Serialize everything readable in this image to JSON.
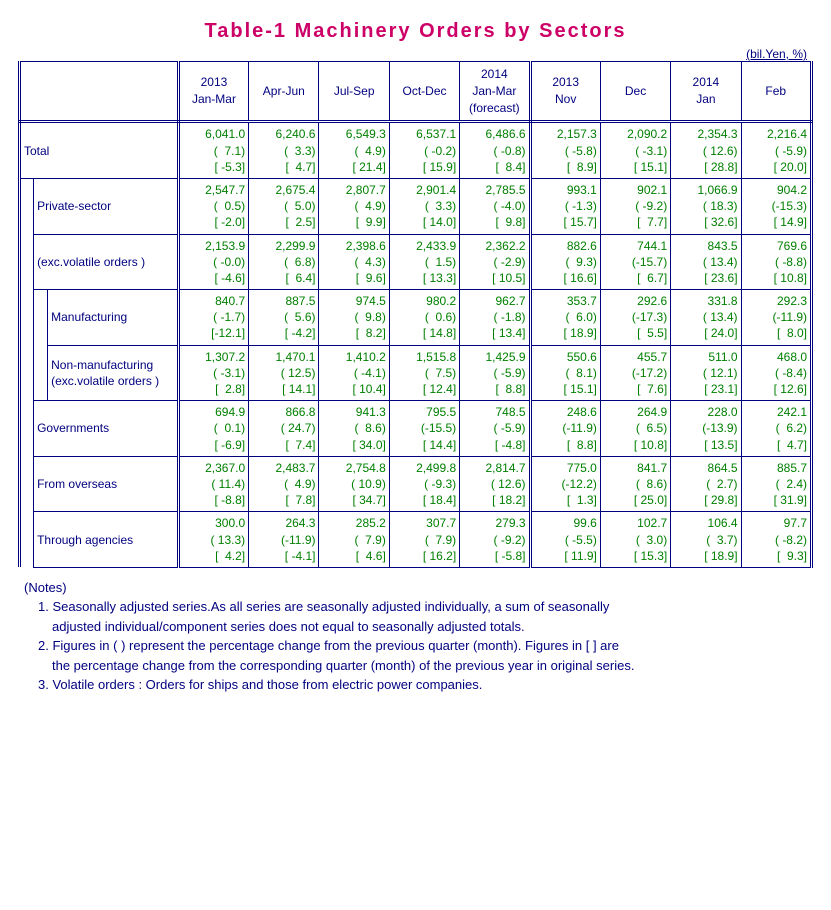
{
  "title": "Table-1   Machinery   Orders   by   Sectors",
  "unit": "(bil.Yen, %)",
  "columns": [
    {
      "l1": "2013",
      "l2": "Jan-Mar",
      "l3": ""
    },
    {
      "l1": "",
      "l2": "Apr-Jun",
      "l3": ""
    },
    {
      "l1": "",
      "l2": "Jul-Sep",
      "l3": ""
    },
    {
      "l1": "",
      "l2": "Oct-Dec",
      "l3": ""
    },
    {
      "l1": "2014",
      "l2": "Jan-Mar",
      "l3": "(forecast)"
    },
    {
      "l1": "2013",
      "l2": "Nov",
      "l3": ""
    },
    {
      "l1": "",
      "l2": "Dec",
      "l3": ""
    },
    {
      "l1": "2014",
      "l2": "Jan",
      "l3": ""
    },
    {
      "l1": "",
      "l2": "Feb",
      "l3": ""
    }
  ],
  "rows": [
    {
      "indent": 0,
      "label": "Total",
      "cells": [
        {
          "v": "6,041.0",
          "p": "(  7.1)",
          "b": "[ -5.3]"
        },
        {
          "v": "6,240.6",
          "p": "(  3.3)",
          "b": "[  4.7]"
        },
        {
          "v": "6,549.3",
          "p": "(  4.9)",
          "b": "[ 21.4]"
        },
        {
          "v": "6,537.1",
          "p": "( -0.2)",
          "b": "[ 15.9]"
        },
        {
          "v": "6,486.6",
          "p": "( -0.8)",
          "b": "[  8.4]"
        },
        {
          "v": "2,157.3",
          "p": "( -5.8)",
          "b": "[  8.9]"
        },
        {
          "v": "2,090.2",
          "p": "( -3.1)",
          "b": "[ 15.1]"
        },
        {
          "v": "2,354.3",
          "p": "( 12.6)",
          "b": "[ 28.8]"
        },
        {
          "v": "2,216.4",
          "p": "( -5.9)",
          "b": "[ 20.0]"
        }
      ]
    },
    {
      "indent": 1,
      "label": "Private-sector",
      "cells": [
        {
          "v": "2,547.7",
          "p": "(  0.5)",
          "b": "[ -2.0]"
        },
        {
          "v": "2,675.4",
          "p": "(  5.0)",
          "b": "[  2.5]"
        },
        {
          "v": "2,807.7",
          "p": "(  4.9)",
          "b": "[  9.9]"
        },
        {
          "v": "2,901.4",
          "p": "(  3.3)",
          "b": "[ 14.0]"
        },
        {
          "v": "2,785.5",
          "p": "( -4.0)",
          "b": "[  9.8]"
        },
        {
          "v": "993.1",
          "p": "( -1.3)",
          "b": "[ 15.7]"
        },
        {
          "v": "902.1",
          "p": "( -9.2)",
          "b": "[  7.7]"
        },
        {
          "v": "1,066.9",
          "p": "( 18.3)",
          "b": "[ 32.6]"
        },
        {
          "v": "904.2",
          "p": "(-15.3)",
          "b": "[ 14.9]"
        }
      ]
    },
    {
      "indent": 1,
      "label": "(exc.volatile orders )",
      "cells": [
        {
          "v": "2,153.9",
          "p": "( -0.0)",
          "b": "[ -4.6]"
        },
        {
          "v": "2,299.9",
          "p": "(  6.8)",
          "b": "[  6.4]"
        },
        {
          "v": "2,398.6",
          "p": "(  4.3)",
          "b": "[  9.6]"
        },
        {
          "v": "2,433.9",
          "p": "(  1.5)",
          "b": "[ 13.3]"
        },
        {
          "v": "2,362.2",
          "p": "( -2.9)",
          "b": "[ 10.5]"
        },
        {
          "v": "882.6",
          "p": "(  9.3)",
          "b": "[ 16.6]"
        },
        {
          "v": "744.1",
          "p": "(-15.7)",
          "b": "[  6.7]"
        },
        {
          "v": "843.5",
          "p": "( 13.4)",
          "b": "[ 23.6]"
        },
        {
          "v": "769.6",
          "p": "( -8.8)",
          "b": "[ 10.8]"
        }
      ]
    },
    {
      "indent": 2,
      "label": "Manufacturing",
      "cells": [
        {
          "v": "840.7",
          "p": "( -1.7)",
          "b": "[-12.1]"
        },
        {
          "v": "887.5",
          "p": "(  5.6)",
          "b": "[ -4.2]"
        },
        {
          "v": "974.5",
          "p": "(  9.8)",
          "b": "[  8.2]"
        },
        {
          "v": "980.2",
          "p": "(  0.6)",
          "b": "[ 14.8]"
        },
        {
          "v": "962.7",
          "p": "( -1.8)",
          "b": "[ 13.4]"
        },
        {
          "v": "353.7",
          "p": "(  6.0)",
          "b": "[ 18.9]"
        },
        {
          "v": "292.6",
          "p": "(-17.3)",
          "b": "[  5.5]"
        },
        {
          "v": "331.8",
          "p": "( 13.4)",
          "b": "[ 24.0]"
        },
        {
          "v": "292.3",
          "p": "(-11.9)",
          "b": "[  8.0]"
        }
      ]
    },
    {
      "indent": 2,
      "label": "Non-manufacturing (exc.volatile orders )",
      "cells": [
        {
          "v": "1,307.2",
          "p": "( -3.1)",
          "b": "[  2.8]"
        },
        {
          "v": "1,470.1",
          "p": "( 12.5)",
          "b": "[ 14.1]"
        },
        {
          "v": "1,410.2",
          "p": "( -4.1)",
          "b": "[ 10.4]"
        },
        {
          "v": "1,515.8",
          "p": "(  7.5)",
          "b": "[ 12.4]"
        },
        {
          "v": "1,425.9",
          "p": "( -5.9)",
          "b": "[  8.8]"
        },
        {
          "v": "550.6",
          "p": "(  8.1)",
          "b": "[ 15.1]"
        },
        {
          "v": "455.7",
          "p": "(-17.2)",
          "b": "[  7.6]"
        },
        {
          "v": "511.0",
          "p": "( 12.1)",
          "b": "[ 23.1]"
        },
        {
          "v": "468.0",
          "p": "( -8.4)",
          "b": "[ 12.6]"
        }
      ]
    },
    {
      "indent": 1,
      "label": "Governments",
      "cells": [
        {
          "v": "694.9",
          "p": "(  0.1)",
          "b": "[ -6.9]"
        },
        {
          "v": "866.8",
          "p": "( 24.7)",
          "b": "[  7.4]"
        },
        {
          "v": "941.3",
          "p": "(  8.6)",
          "b": "[ 34.0]"
        },
        {
          "v": "795.5",
          "p": "(-15.5)",
          "b": "[ 14.4]"
        },
        {
          "v": "748.5",
          "p": "( -5.9)",
          "b": "[ -4.8]"
        },
        {
          "v": "248.6",
          "p": "(-11.9)",
          "b": "[  8.8]"
        },
        {
          "v": "264.9",
          "p": "(  6.5)",
          "b": "[ 10.8]"
        },
        {
          "v": "228.0",
          "p": "(-13.9)",
          "b": "[ 13.5]"
        },
        {
          "v": "242.1",
          "p": "(  6.2)",
          "b": "[  4.7]"
        }
      ]
    },
    {
      "indent": 1,
      "label": "From overseas",
      "cells": [
        {
          "v": "2,367.0",
          "p": "( 11.4)",
          "b": "[ -8.8]"
        },
        {
          "v": "2,483.7",
          "p": "(  4.9)",
          "b": "[  7.8]"
        },
        {
          "v": "2,754.8",
          "p": "( 10.9)",
          "b": "[ 34.7]"
        },
        {
          "v": "2,499.8",
          "p": "( -9.3)",
          "b": "[ 18.4]"
        },
        {
          "v": "2,814.7",
          "p": "( 12.6)",
          "b": "[ 18.2]"
        },
        {
          "v": "775.0",
          "p": "(-12.2)",
          "b": "[  1.3]"
        },
        {
          "v": "841.7",
          "p": "(  8.6)",
          "b": "[ 25.0]"
        },
        {
          "v": "864.5",
          "p": "(  2.7)",
          "b": "[ 29.8]"
        },
        {
          "v": "885.7",
          "p": "(  2.4)",
          "b": "[ 31.9]"
        }
      ]
    },
    {
      "indent": 1,
      "label": "Through agencies",
      "cells": [
        {
          "v": "300.0",
          "p": "( 13.3)",
          "b": "[  4.2]"
        },
        {
          "v": "264.3",
          "p": "(-11.9)",
          "b": "[ -4.1]"
        },
        {
          "v": "285.2",
          "p": "(  7.9)",
          "b": "[  4.6]"
        },
        {
          "v": "307.7",
          "p": "(  7.9)",
          "b": "[ 16.2]"
        },
        {
          "v": "279.3",
          "p": "( -9.2)",
          "b": "[ -5.8]"
        },
        {
          "v": "99.6",
          "p": "( -5.5)",
          "b": "[ 11.9]"
        },
        {
          "v": "102.7",
          "p": "(  3.0)",
          "b": "[ 15.3]"
        },
        {
          "v": "106.4",
          "p": "(  3.7)",
          "b": "[ 18.9]"
        },
        {
          "v": "97.7",
          "p": "( -8.2)",
          "b": "[  9.3]"
        }
      ]
    }
  ],
  "notes": {
    "header": "(Notes)",
    "n1a": "1. Seasonally adjusted series.As all series are seasonally adjusted individually, a sum of seasonally",
    "n1b": "adjusted individual/component series does not equal to seasonally adjusted totals.",
    "n2a": "2. Figures in ( ) represent the percentage change from the previous quarter (month). Figures in [ ] are",
    "n2b": "the percentage change from the corresponding quarter (month) of the previous year in original series.",
    "n3": "3. Volatile orders : Orders for ships and those from electric power companies."
  }
}
